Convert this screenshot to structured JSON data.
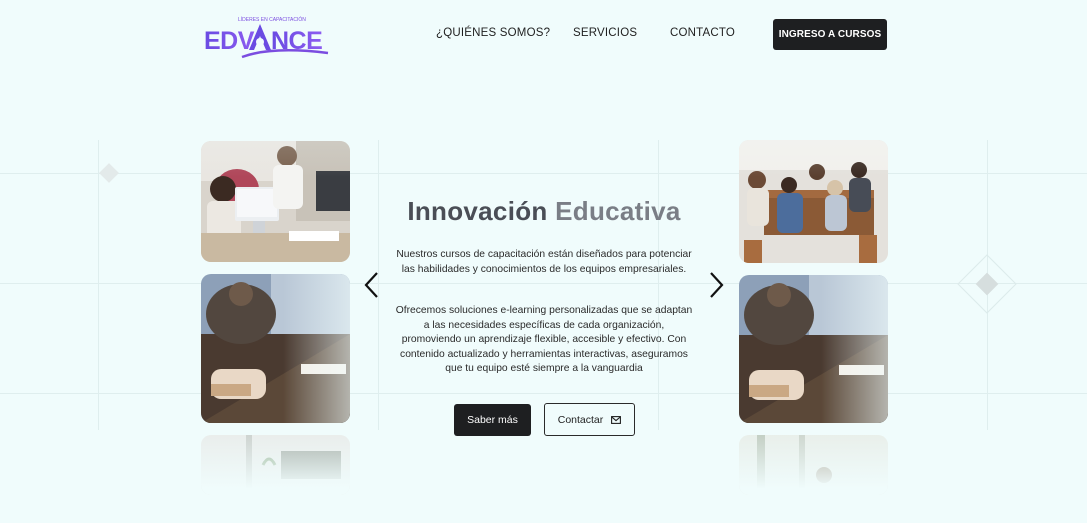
{
  "brand": {
    "name": "EDVANCE",
    "tagline": "LÍDERES EN CAPACITACIÓN",
    "colors": {
      "primary": "#7b4de0",
      "secondary": "#5a3fd6",
      "dark": "#1e1f21",
      "background": "#f0fcfc"
    }
  },
  "nav": {
    "items": [
      {
        "label": "¿QUIÉNES SOMOS?"
      },
      {
        "label": "SERVICIOS"
      },
      {
        "label": "CONTACTO"
      }
    ],
    "cta_label": "INGRESO A CURSOS"
  },
  "hero": {
    "title_main": "Innovación",
    "title_accent": "Educativa",
    "paragraph_1": "Nuestros cursos de capacitación están diseñados para potenciar las habilidades y conocimientos de los equipos empresariales.",
    "paragraph_2": "Ofrecemos soluciones e-learning personalizadas que se adaptan a las necesidades específicas de cada organización, promoviendo un aprendizaje flexible, accesible y efectivo. Con contenido actualizado y herramientas interactivas, aseguramos que tu equipo esté siempre a la vanguardia",
    "primary_button": "Saber más",
    "secondary_button": "Contactar",
    "secondary_icon": "mail-icon"
  },
  "carousel": {
    "prev_icon": "chevron-left-icon",
    "next_icon": "chevron-right-icon"
  },
  "photos": [
    {
      "name": "photo-office-computers"
    },
    {
      "name": "photo-team-meeting"
    },
    {
      "name": "photo-hands-writing"
    },
    {
      "name": "photo-hands-writing"
    },
    {
      "name": "photo-plant-desk"
    },
    {
      "name": "photo-window-office"
    }
  ]
}
